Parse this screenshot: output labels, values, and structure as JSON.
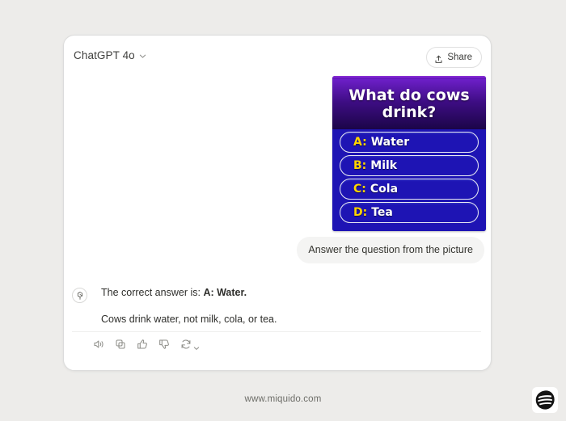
{
  "page": {
    "background_color": "#edecea",
    "footer_url": "www.miquido.com",
    "brand_logo_name": "miquido-logo"
  },
  "card": {
    "header": {
      "model_name": "ChatGPT 4o",
      "model_chevron_icon": "chevron-down-icon",
      "share_label": "Share",
      "share_icon": "share-upload-icon"
    }
  },
  "attachment": {
    "type": "quiz-image",
    "question": "What do cows drink?",
    "answers": [
      {
        "letter": "A:",
        "text": "Water"
      },
      {
        "letter": "B:",
        "text": "Milk"
      },
      {
        "letter": "C:",
        "text": "Cola"
      },
      {
        "letter": "D:",
        "text": "Tea"
      }
    ],
    "colors": {
      "question_background": "#3e0d84",
      "answers_background": "#1e14b4",
      "letter_color": "#ffd400",
      "text_color": "#ffffff"
    }
  },
  "conversation": {
    "user_message": "Answer the question from the picture",
    "assistant": {
      "avatar_icon": "openai-logo-icon",
      "line1_prefix": "The correct answer is: ",
      "line1_bold": "A: Water.",
      "line2": "Cows drink water, not milk, cola, or tea."
    }
  },
  "actions": [
    {
      "name": "read-aloud-icon",
      "label": "Read aloud"
    },
    {
      "name": "copy-icon",
      "label": "Copy"
    },
    {
      "name": "thumbs-up-icon",
      "label": "Good response"
    },
    {
      "name": "thumbs-down-icon",
      "label": "Bad response"
    },
    {
      "name": "regenerate-icon",
      "label": "Regenerate"
    }
  ]
}
